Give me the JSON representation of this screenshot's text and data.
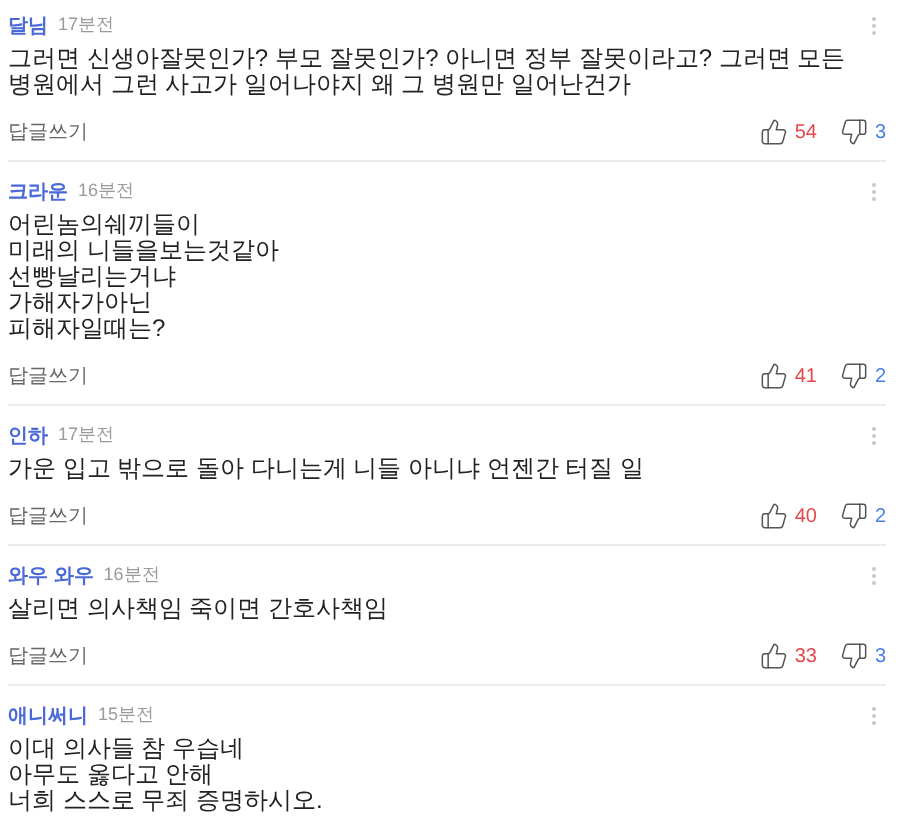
{
  "comments": [
    {
      "author": "달님",
      "time": "17분전",
      "lines": [
        "그러면 신생아잘못인가? 부모 잘못인가? 아니면 정부 잘못이라고? 그러면 모든 병원에서 그런 사고가 일어나야지 왜 그 병원만 일어난건가"
      ],
      "reply_label": "답글쓰기",
      "likes": "54",
      "dislikes": "3"
    },
    {
      "author": "크라운",
      "time": "16분전",
      "lines": [
        "어린놈의쉐끼들이",
        "미래의 니들을보는것같아",
        "선빵날리는거냐",
        "가해자가아닌",
        "피해자일때는?"
      ],
      "reply_label": "답글쓰기",
      "likes": "41",
      "dislikes": "2"
    },
    {
      "author": "인하",
      "time": "17분전",
      "lines": [
        "가운 입고 밖으로 돌아 다니는게 니들 아니냐  언젠간 터질 일"
      ],
      "reply_label": "답글쓰기",
      "likes": "40",
      "dislikes": "2"
    },
    {
      "author": "와우 와우",
      "time": "16분전",
      "lines": [
        "살리면 의사책임 죽이면 간호사책임"
      ],
      "reply_label": "답글쓰기",
      "likes": "33",
      "dislikes": "3"
    },
    {
      "author": "애니써니",
      "time": "15분전",
      "lines": [
        "이대 의사들 참 우습네",
        "아무도 옳다고 안해",
        "너희 스스로 무죄 증명하시오."
      ]
    }
  ]
}
